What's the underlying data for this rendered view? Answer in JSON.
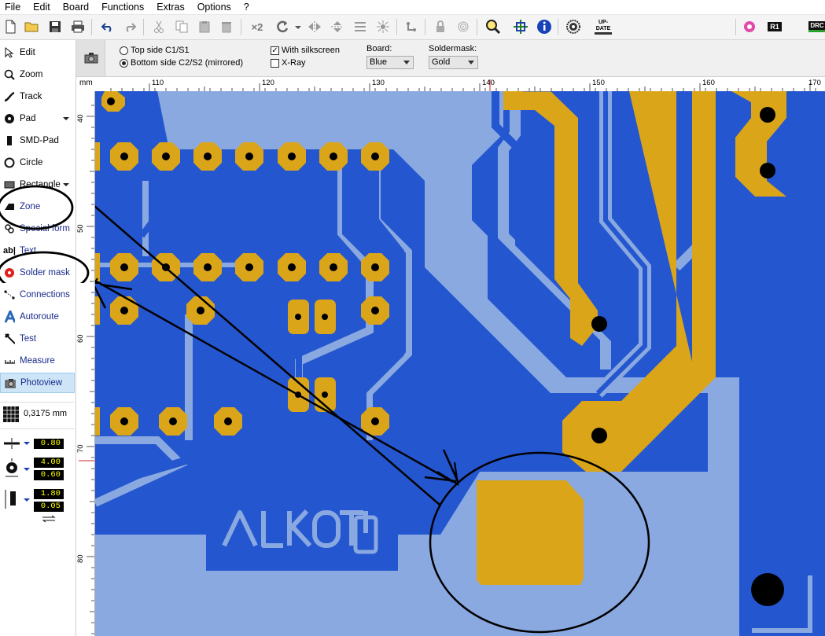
{
  "menu": [
    "File",
    "Edit",
    "Board",
    "Functions",
    "Extras",
    "Options",
    "?"
  ],
  "toolbar": {
    "zoom_x2": "×2",
    "update": "UP-DATE",
    "r1": "R1",
    "drc": "DRC"
  },
  "sidebar": {
    "items": [
      {
        "label": "Edit",
        "icon": "cursor-arrow-icon"
      },
      {
        "label": "Zoom",
        "icon": "magnifier-icon"
      },
      {
        "label": "Track",
        "icon": "track-icon"
      },
      {
        "label": "Pad",
        "icon": "pad-icon"
      },
      {
        "label": "SMD-Pad",
        "icon": "smd-pad-icon"
      },
      {
        "label": "Circle",
        "icon": "circle-icon"
      },
      {
        "label": "Rectangle",
        "icon": "rectangle-icon"
      },
      {
        "label": "Zone",
        "icon": "zone-icon"
      },
      {
        "label": "Special form",
        "icon": "special-form-icon"
      },
      {
        "label": "Text",
        "icon": "text-icon"
      },
      {
        "label": "Solder mask",
        "icon": "solder-mask-icon"
      },
      {
        "label": "Connections",
        "icon": "connections-icon"
      },
      {
        "label": "Autoroute",
        "icon": "autoroute-icon"
      },
      {
        "label": "Test",
        "icon": "test-icon"
      },
      {
        "label": "Measure",
        "icon": "measure-icon"
      },
      {
        "label": "Photoview",
        "icon": "camera-icon"
      }
    ],
    "grid": "0,3175 mm",
    "track_width": "0.80",
    "pad_outer": "4.00",
    "pad_inner": "0.60",
    "smd_w": "1.80",
    "smd_h": "0.05"
  },
  "photoview": {
    "top_side": "Top side C1/S1",
    "bottom_side": "Bottom side C2/S2 (mirrored)",
    "with_silkscreen": "With silkscreen",
    "xray": "X-Ray",
    "board_label": "Board:",
    "board_value": "Blue",
    "soldermask_label": "Soldermask:",
    "soldermask_value": "Gold"
  },
  "ruler": {
    "unit": "mm",
    "top": [
      "110",
      "120",
      "130",
      "140",
      "150",
      "160",
      "170"
    ],
    "left": [
      "40",
      "50",
      "60",
      "70",
      "80"
    ]
  },
  "board_text": "ALKOTO",
  "colors": {
    "board_light": "#8aa9e0",
    "copper_blue": "#2456cf",
    "gold": "#dba51a",
    "annotation": "#000000"
  }
}
